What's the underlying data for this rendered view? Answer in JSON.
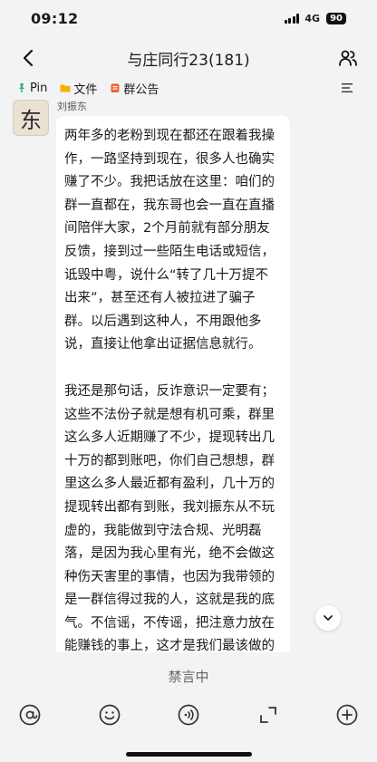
{
  "status_bar": {
    "time": "09:12",
    "network": "4G",
    "battery": "90"
  },
  "header": {
    "title": "与庄同行23(181)"
  },
  "tabs": [
    {
      "label": "Pin",
      "icon": "pin-icon",
      "color": "#2db36a"
    },
    {
      "label": "文件",
      "icon": "folder-icon",
      "color": "#f5b300"
    },
    {
      "label": "群公告",
      "icon": "announcement-icon",
      "color": "#f0632e"
    }
  ],
  "message": {
    "sender": "刘振东",
    "avatar_char": "东",
    "paragraphs": [
      "两年多的老粉到现在都还在跟着我操作，一路坚持到现在，很多人也确实赚了不少。我把话放在这里：咱们的群一直都在，我东哥也会一直在直播间陪伴大家，2个月前就有部分朋友反馈，接到过一些陌生电话或短信，诋毁中粤，说什么“转了几十万提不出来”，甚至还有人被拉进了骗子群。以后遇到这种人，不用跟他多说，直接让他拿出证据信息就行。",
      "我还是那句话，反诈意识一定要有；这些不法份子就是想有机可乘，群里这么多人近期赚了不少，提现转出几十万的都到账吧，你们自己想想，群里这么多人最近都有盈利，几十万的提现转出都有到账，我刘振东从不玩虚的，我能做到守法合规、光明磊落，是因为我心里有光，绝不会做这种伤天害里的事情，也因为我带领的是一群信得过我的人，这就是我的底气。不信谣，不传谣，把注意力放在能赚钱的事上，这才是我们最该做的"
    ]
  },
  "bottom": {
    "muted_label": "禁言中",
    "tools": [
      "at-icon",
      "emoji-icon",
      "voice-icon",
      "expand-icon",
      "add-icon"
    ]
  }
}
